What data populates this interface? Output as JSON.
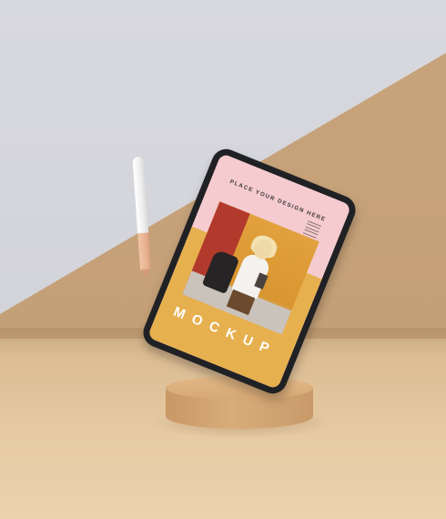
{
  "scene": {
    "colors": {
      "wall_grey": "#d3d4d9",
      "wall_tan": "#c6a178",
      "floor": "#e3c69f",
      "pedestal": "#d9ab78",
      "tablet_frame": "#202124",
      "screen_pink": "#f5cbcf",
      "screen_gold": "#e7b04e"
    },
    "icons": [
      "stylus-pen",
      "tablet-device",
      "cylinder-pedestal"
    ]
  },
  "tablet": {
    "headline": "PLACE YOUR DESIGN HERE",
    "word": "MOCKUP"
  }
}
